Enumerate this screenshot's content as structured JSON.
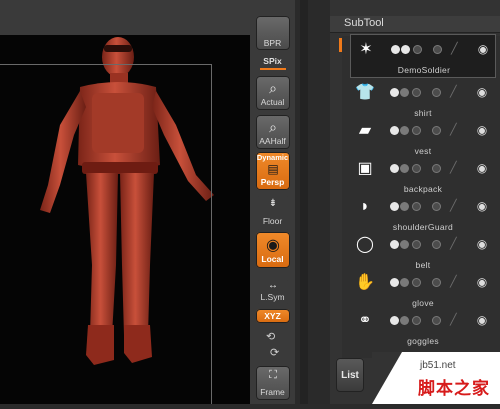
{
  "toolbar": {
    "buttons": [
      {
        "name": "bpr",
        "label": "BPR"
      },
      {
        "name": "spix",
        "label": "SPix"
      },
      {
        "name": "actual",
        "label": "Actual"
      },
      {
        "name": "aahalf",
        "label": "AAHalf"
      },
      {
        "name": "dynamic",
        "label": "Dynamic"
      },
      {
        "name": "persp",
        "label": "Persp"
      },
      {
        "name": "floor",
        "label": "Floor"
      },
      {
        "name": "local",
        "label": "Local"
      },
      {
        "name": "lsym",
        "label": "L.Sym"
      },
      {
        "name": "xyz",
        "label": "XYZ"
      },
      {
        "name": "frame",
        "label": "Frame"
      }
    ]
  },
  "subtool": {
    "title": "SubTool",
    "items": [
      {
        "name": "DemoSoldier",
        "icon": "soldier-icon"
      },
      {
        "name": "shirt",
        "icon": "shirt-icon"
      },
      {
        "name": "vest",
        "icon": "vest-icon"
      },
      {
        "name": "backpack",
        "icon": "backpack-icon"
      },
      {
        "name": "shoulderGuard",
        "icon": "shoulderguard-icon"
      },
      {
        "name": "belt",
        "icon": "belt-icon"
      },
      {
        "name": "glove",
        "icon": "glove-icon"
      },
      {
        "name": "goggles",
        "icon": "goggles-icon"
      }
    ],
    "list_label": "List"
  },
  "watermark": {
    "site": "jb51.net",
    "text": "脚本之家"
  },
  "colors": {
    "accent": "#f07a1a",
    "model": "#b8402f"
  }
}
